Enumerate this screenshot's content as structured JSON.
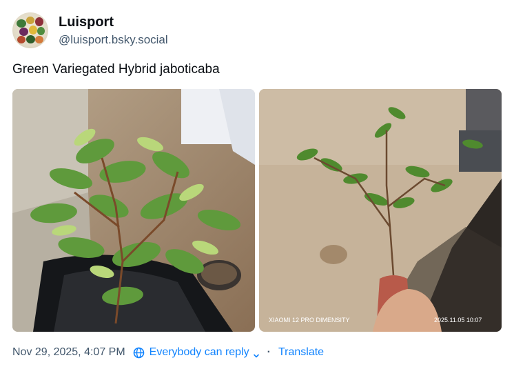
{
  "post": {
    "author": {
      "display_name": "Luisport",
      "handle": "@luisport.bsky.social"
    },
    "text": "Green Variegated Hybrid jaboticaba",
    "images": [
      {
        "alt": "Variegated jaboticaba plant in a black nursery bag"
      },
      {
        "alt": "Small jaboticaba sapling held over concrete",
        "watermark_left": "XIAOMI 12 PRO DIMENSITY",
        "watermark_right": "2025.11.05  10:07"
      }
    ],
    "footer": {
      "timestamp": "Nov 29, 2025, 4:07 PM",
      "reply_setting": "Everybody can reply",
      "separator": "·",
      "translate": "Translate"
    }
  },
  "colors": {
    "link": "#1083fe",
    "muted": "#42576c",
    "text": "#0b0f14"
  }
}
